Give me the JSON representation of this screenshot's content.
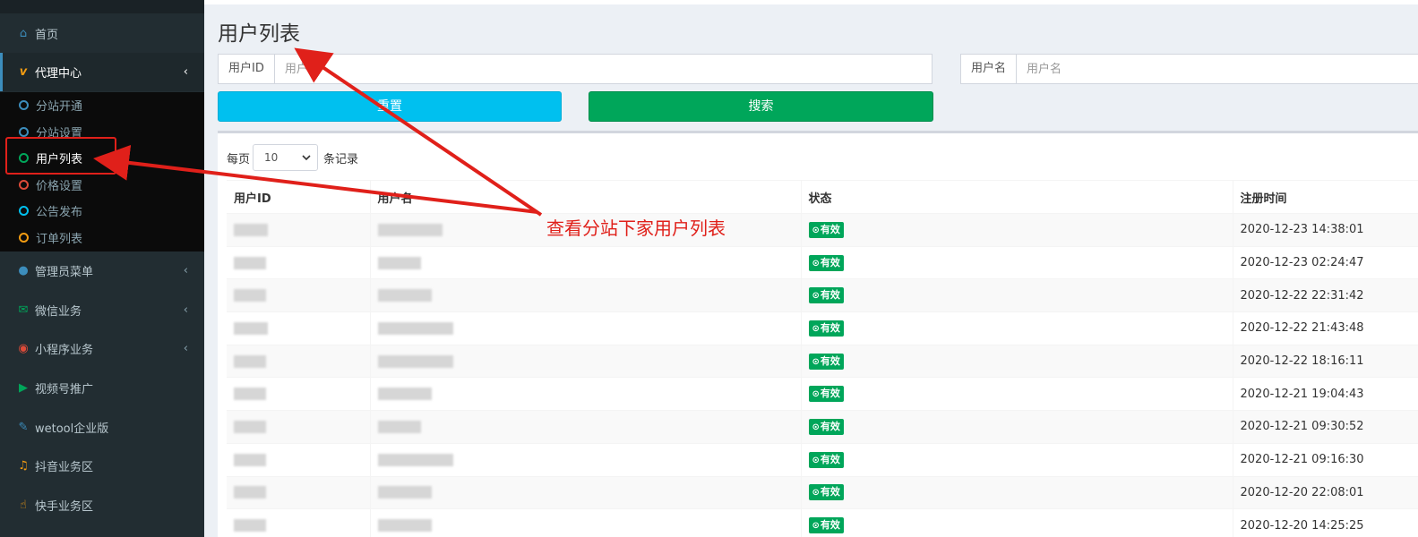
{
  "sidebar": {
    "items": [
      {
        "name": "sidebar-item-home",
        "icon": "home-icon",
        "glyph": "⌂",
        "color": "#3c8dbc",
        "label": "首页",
        "chevron": false
      },
      {
        "name": "sidebar-item-agent-center",
        "icon": "vimeo-v-icon",
        "glyph": "v",
        "color": "#f39c12",
        "label": "代理中心",
        "chevron": true,
        "active": true
      },
      {
        "name": "sidebar-item-admin-menu",
        "icon": "user-icon",
        "glyph": "●",
        "color": "#3c8dbc",
        "label": "管理员菜单",
        "chevron": true
      },
      {
        "name": "sidebar-item-wechat",
        "icon": "wechat-icon",
        "glyph": "✉",
        "color": "#00a65a",
        "label": "微信业务",
        "chevron": true
      },
      {
        "name": "sidebar-item-miniprogram",
        "icon": "github-icon",
        "glyph": "◉",
        "color": "#dd4b39",
        "label": "小程序业务",
        "chevron": true
      },
      {
        "name": "sidebar-item-video",
        "icon": "video-camera-icon",
        "glyph": "▶",
        "color": "#00a65a",
        "label": "视频号推广",
        "chevron": false
      },
      {
        "name": "sidebar-item-wetool",
        "icon": "wrench-icon",
        "glyph": "✎",
        "color": "#3c8dbc",
        "label": "wetool企业版",
        "chevron": false
      },
      {
        "name": "sidebar-item-douyin",
        "icon": "music-icon",
        "glyph": "♫",
        "color": "#f39c12",
        "label": "抖音业务区",
        "chevron": false
      },
      {
        "name": "sidebar-item-kuaishou",
        "icon": "hand-pointer-icon",
        "glyph": "☝",
        "color": "#f39c12",
        "label": "快手业务区",
        "chevron": false
      }
    ],
    "subitems": [
      {
        "name": "subitem-branch-open",
        "label": "分站开通",
        "color": "#3c8dbc"
      },
      {
        "name": "subitem-branch-settings",
        "label": "分站设置",
        "color": "#3c8dbc"
      },
      {
        "name": "subitem-user-list",
        "label": "用户列表",
        "color": "#00a65a",
        "current": true
      },
      {
        "name": "subitem-price-settings",
        "label": "价格设置",
        "color": "#dd4b39"
      },
      {
        "name": "subitem-announcement",
        "label": "公告发布",
        "color": "#00c0ef"
      },
      {
        "name": "subitem-order-list",
        "label": "订单列表",
        "color": "#f39c12"
      }
    ]
  },
  "main": {
    "title": "用户列表",
    "filters": {
      "user_id_label": "用户ID",
      "user_id_placeholder": "用户ID",
      "username_label": "用户名",
      "username_placeholder": "用户名"
    },
    "buttons": {
      "reset": "重置",
      "search": "搜索"
    },
    "length": {
      "prefix": "每页",
      "value": "10",
      "suffix": "条记录"
    },
    "table": {
      "columns": [
        "用户ID",
        "用户名",
        "状态",
        "注册时间"
      ],
      "status_label": "有效",
      "rows": [
        {
          "time": "2020-12-23 14:38:01"
        },
        {
          "time": "2020-12-23 02:24:47"
        },
        {
          "time": "2020-12-22 22:31:42"
        },
        {
          "time": "2020-12-22 21:43:48"
        },
        {
          "time": "2020-12-22 18:16:11"
        },
        {
          "time": "2020-12-21 19:04:43"
        },
        {
          "time": "2020-12-21 09:30:52"
        },
        {
          "time": "2020-12-21 09:16:30"
        },
        {
          "time": "2020-12-20 22:08:01"
        },
        {
          "time": "2020-12-20 14:25:25"
        }
      ]
    }
  },
  "annotation": {
    "text": "查看分站下家用户列表",
    "color": "#e0201a"
  }
}
